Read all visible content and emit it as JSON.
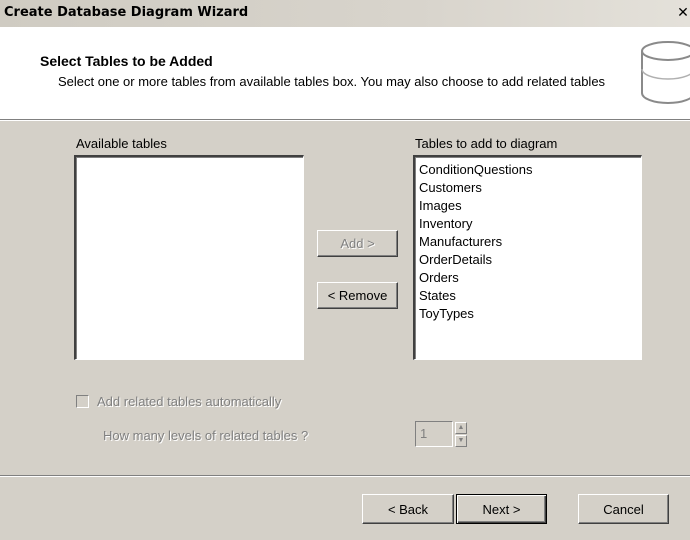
{
  "window": {
    "title": "Create Database Diagram Wizard",
    "close_glyph": "✕"
  },
  "header": {
    "title": "Select Tables to be Added",
    "subtitle": "Select one or more tables from available tables box. You may also choose to add related tables",
    "icon": "database-cylinder-icon"
  },
  "available": {
    "label": "Available tables",
    "items": []
  },
  "selected": {
    "label": "Tables to add to diagram",
    "items": [
      "ConditionQuestions",
      "Customers",
      "Images",
      "Inventory",
      "Manufacturers",
      "OrderDetails",
      "Orders",
      "States",
      "ToyTypes"
    ]
  },
  "buttons": {
    "add": "Add >",
    "remove": "< Remove"
  },
  "options": {
    "related_checkbox_label": "Add related tables automatically",
    "related_checked": false,
    "levels_label": "How many levels of related tables ?",
    "levels_value": "1"
  },
  "footer": {
    "back": "< Back",
    "next": "Next >",
    "cancel": "Cancel"
  }
}
